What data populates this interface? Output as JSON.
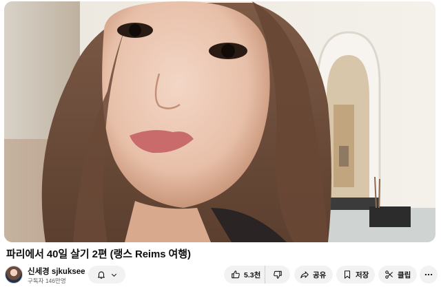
{
  "video": {
    "title": "파리에서 40일 살기 2편 (랭스 Reims 여행)"
  },
  "channel": {
    "name": "신세경 sjkuksee",
    "subscribers": "구독자 146만명"
  },
  "actions": {
    "like_count": "5.3천",
    "share_label": "공유",
    "save_label": "저장",
    "clip_label": "클립"
  },
  "icons": {
    "bell": "bell-icon",
    "chevron": "chevron-down-icon",
    "like": "thumbs-up-icon",
    "dislike": "thumbs-down-icon",
    "share": "share-arrow-icon",
    "save": "bookmark-icon",
    "clip": "scissors-icon",
    "more": "more-horizontal-icon"
  }
}
